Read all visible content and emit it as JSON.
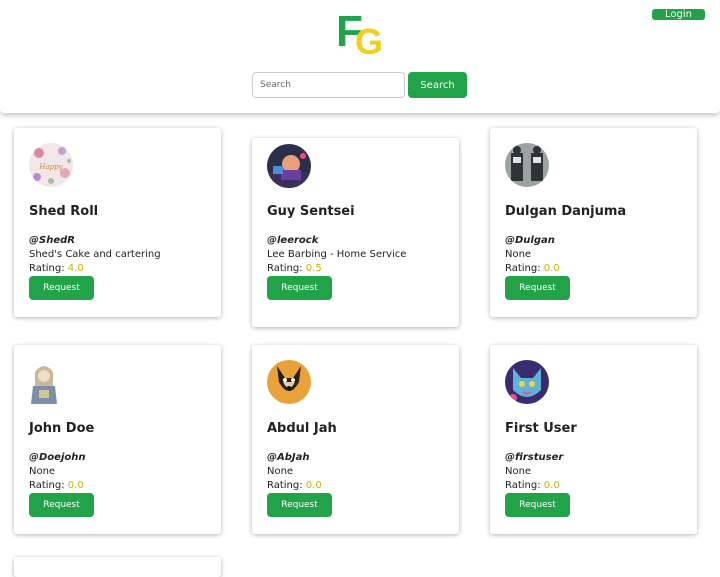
{
  "header": {
    "logo_letters": [
      "F",
      "G"
    ],
    "login_label": "Login",
    "search_placeholder": "Search",
    "search_label": "Search"
  },
  "rating_prefix": "Rating: ",
  "request_label": "Request",
  "colors": {
    "accent": "#22a34a",
    "rating": "#c7b400",
    "logo_yellow": "#f2cf1a"
  },
  "cards": [
    {
      "name": "Shed Roll",
      "handle": "@ShedR",
      "bio": "Shed's Cake and cartering",
      "rating": "4.0",
      "avatar_icon": "floral-avatar-icon"
    },
    {
      "name": "Guy Sentsei",
      "handle": "@leerock",
      "bio": "Lee Barbing - Home Service",
      "rating": "0.5",
      "avatar_icon": "gamer-avatar-icon"
    },
    {
      "name": "Dulgan Danjuma",
      "handle": "@Dulgan",
      "bio": "None",
      "rating": "0.0",
      "avatar_icon": "figures-avatar-icon"
    },
    {
      "name": "John Doe",
      "handle": "@Doejohn",
      "bio": "None",
      "rating": "0.0",
      "avatar_icon": "anime-avatar-icon"
    },
    {
      "name": "Abdul Jah",
      "handle": "@AbJah",
      "bio": "None",
      "rating": "0.0",
      "avatar_icon": "dog-avatar-icon"
    },
    {
      "name": "First User",
      "handle": "@firstuser",
      "bio": "None",
      "rating": "0.0",
      "avatar_icon": "cat-avatar-icon"
    }
  ]
}
